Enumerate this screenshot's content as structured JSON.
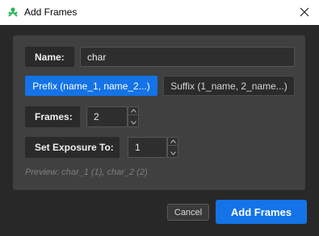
{
  "window": {
    "title": "Add Frames",
    "app_icon": "app-icon",
    "close_icon": "close-icon"
  },
  "form": {
    "name_label": "Name:",
    "name_value": "char",
    "prefix_option": "Prefix (name_1, name_2...)",
    "suffix_option": "Suffix (1_name, 2_name...)",
    "selected_option": "prefix",
    "frames_label": "Frames:",
    "frames_value": "2",
    "exposure_label": "Set Exposure To:",
    "exposure_value": "1",
    "preview": "Preview: char_1 (1), char_2 (2)"
  },
  "buttons": {
    "cancel": "Cancel",
    "add_frames": "Add Frames"
  },
  "colors": {
    "accent": "#1473e6",
    "panel": "#404040",
    "background": "#282828"
  }
}
